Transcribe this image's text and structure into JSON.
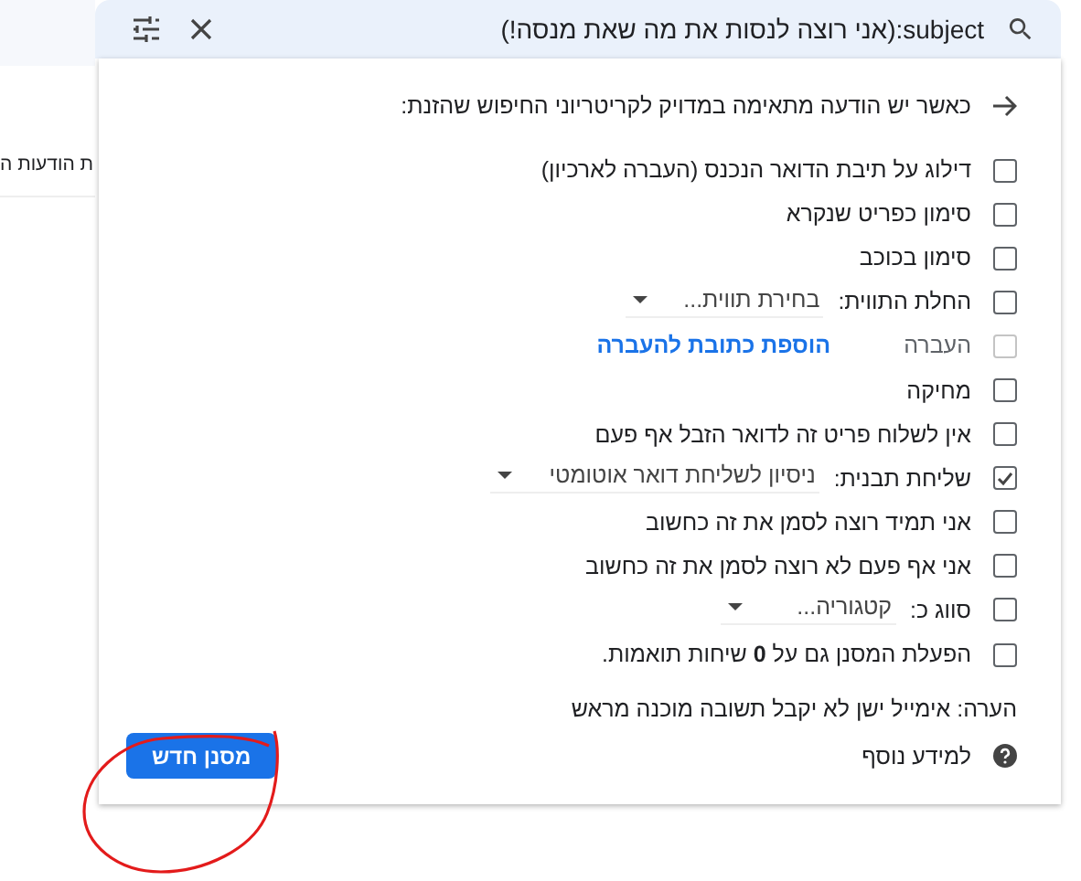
{
  "background": {
    "text": "ת הודעות ה"
  },
  "search": {
    "value": "subject:(אני רוצה לנסות את מה שאת מנסה!)"
  },
  "panel": {
    "heading": "כאשר יש הודעה מתאימה במדויק לקריטריוני החיפוש שהזנת:",
    "actions": [
      {
        "kind": "check",
        "label": "דילוג על תיבת הדואר הנכנס (העברה לארכיון)",
        "checked": false,
        "disabled": false
      },
      {
        "kind": "check",
        "label": "סימון כפריט שנקרא",
        "checked": false,
        "disabled": false
      },
      {
        "kind": "check",
        "label": "סימון בכוכב",
        "checked": false,
        "disabled": false
      },
      {
        "kind": "select",
        "label": "החלת התווית:",
        "placeholder": "בחירת תווית...",
        "checked": false,
        "disabled": false
      },
      {
        "kind": "link",
        "label": "העברה",
        "link": "הוספת כתובת להעברה",
        "checked": false,
        "disabled": true
      },
      {
        "kind": "check",
        "label": "מחיקה",
        "checked": false,
        "disabled": false
      },
      {
        "kind": "check",
        "label": "אין לשלוח פריט זה לדואר הזבל אף פעם",
        "checked": false,
        "disabled": false
      },
      {
        "kind": "select",
        "label": "שליחת תבנית:",
        "value": "ניסיון לשליחת דואר אוטומטי",
        "checked": true,
        "disabled": false
      },
      {
        "kind": "check",
        "label": "אני תמיד רוצה לסמן את זה כחשוב",
        "checked": false,
        "disabled": false
      },
      {
        "kind": "check",
        "label": "אני אף פעם לא רוצה לסמן את זה כחשוב",
        "checked": false,
        "disabled": false
      },
      {
        "kind": "select",
        "label": "סווג כ:",
        "placeholder": "קטגוריה...",
        "checked": false,
        "disabled": false
      },
      {
        "kind": "check",
        "label": "הפעלת המסנן גם על **0** שיחות תואמות.",
        "checked": false,
        "disabled": false
      }
    ],
    "note": "הערה: אימייל ישן לא יקבל תשובה מוכנה מראש",
    "help_link": "למידע נוסף",
    "create_button": "מסנן חדש"
  }
}
